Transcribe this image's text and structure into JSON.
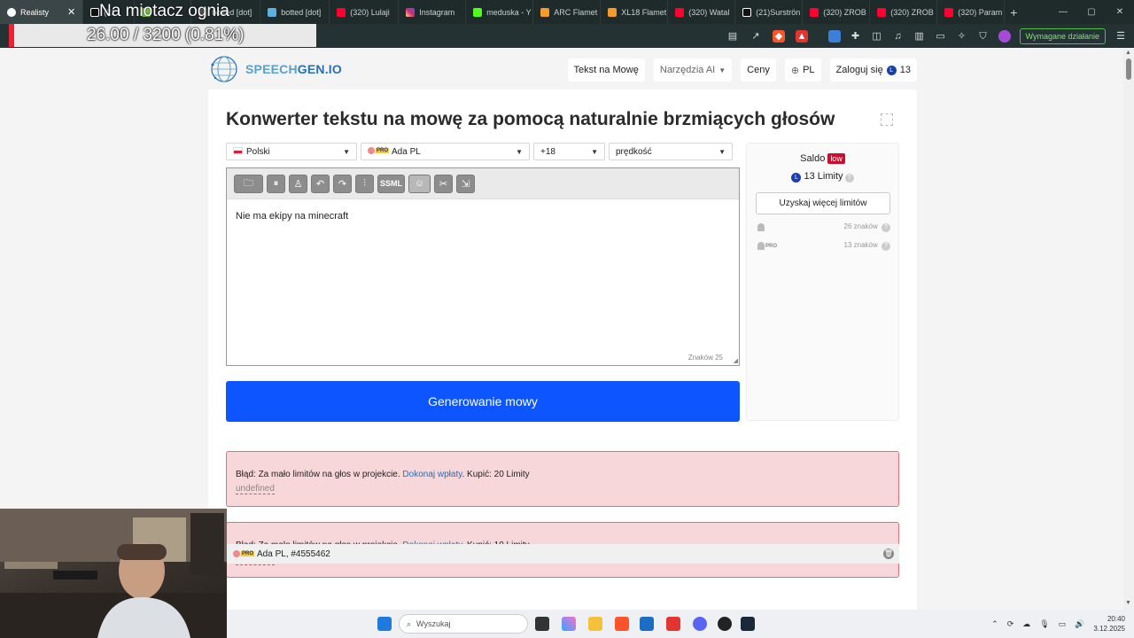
{
  "browser": {
    "tabs": [
      {
        "label": "Realisty",
        "color": "#ffffff",
        "active": true
      },
      {
        "label": "(21",
        "color": "#111111"
      },
      {
        "label": "",
        "color": "#7ac943"
      },
      {
        "label": "botted [dot]",
        "color": "#444444"
      },
      {
        "label": "botted [dot]",
        "color": "#5ab0e0"
      },
      {
        "label": "(320) Lulaji",
        "color": "#ff0033"
      },
      {
        "label": "Instagram",
        "color": "#d6249f"
      },
      {
        "label": "meduska - Y",
        "color": "#53fc18"
      },
      {
        "label": "ARC Flamet",
        "color": "#f59b2b"
      },
      {
        "label": "XL18 Flamet",
        "color": "#f59b2b"
      },
      {
        "label": "(320) Watal",
        "color": "#ff0033"
      },
      {
        "label": "(21)Surströn",
        "color": "#111111"
      },
      {
        "label": "(320) ZROB",
        "color": "#ff0033"
      },
      {
        "label": "(320) ZROB",
        "color": "#ff0033"
      },
      {
        "label": "(320) Param",
        "color": "#ff0033"
      }
    ],
    "tab_close": "✕",
    "new_tab": "+",
    "window_controls": [
      "—",
      "▢",
      "✕"
    ],
    "required_action": "Wymagane działanie"
  },
  "stream_overlay": {
    "title": "Na miotacz ognia",
    "progress_text": "26.00 / 3200 (0.81%)",
    "progress_fraction": 0.0081
  },
  "site": {
    "logo_prefix": "SPEECH",
    "logo_suffix": "GEN.IO",
    "nav": {
      "tts": "Tekst na Mowę",
      "ai_tools": "Narzędzia AI",
      "ai_tools_caret": "▼",
      "prices": "Ceny",
      "lang": "PL",
      "login": "Zaloguj się",
      "credits": "13"
    }
  },
  "main": {
    "title": "Konwerter tekstu na mowę za pomocą naturalnie brzmiących głosów",
    "language_select": "Polski",
    "voice_select": "Ada PL",
    "pro_badge": "PRO",
    "pitch_select": "+18",
    "speed_select": "prędkość",
    "toolbar": {
      "ssml": "SSML"
    },
    "text": "Nie ma ekipy na minecraft",
    "char_count_label": "Znaków",
    "char_count": "25",
    "generate_button": "Generowanie mowy"
  },
  "sidebar": {
    "saldo_label": "Saldo",
    "low_badge": "low",
    "limits_value": "13 Limity",
    "help": "?",
    "more_limits_button": "Uzyskaj więcej limitów",
    "quota_free": "26 znaków",
    "quota_pro": "13 znaków"
  },
  "alerts": [
    {
      "prefix": "Błąd: Za mało limitów na głos w projekcie. ",
      "link": "Dokonaj wpłaty",
      "suffix": ". Kupić: 20 Limity",
      "detail": "undefined"
    },
    {
      "prefix": "Błąd: Za mało limitów na głos w projekcie. ",
      "link": "Dokonaj wpłaty",
      "suffix": ". Kupić: 10 Limity",
      "detail": "undefined"
    }
  ],
  "history": {
    "item": "Ada PL, #4555462"
  },
  "taskbar": {
    "search_placeholder": "Wyszukaj",
    "time": "20:40",
    "date": "3.12.2025"
  }
}
